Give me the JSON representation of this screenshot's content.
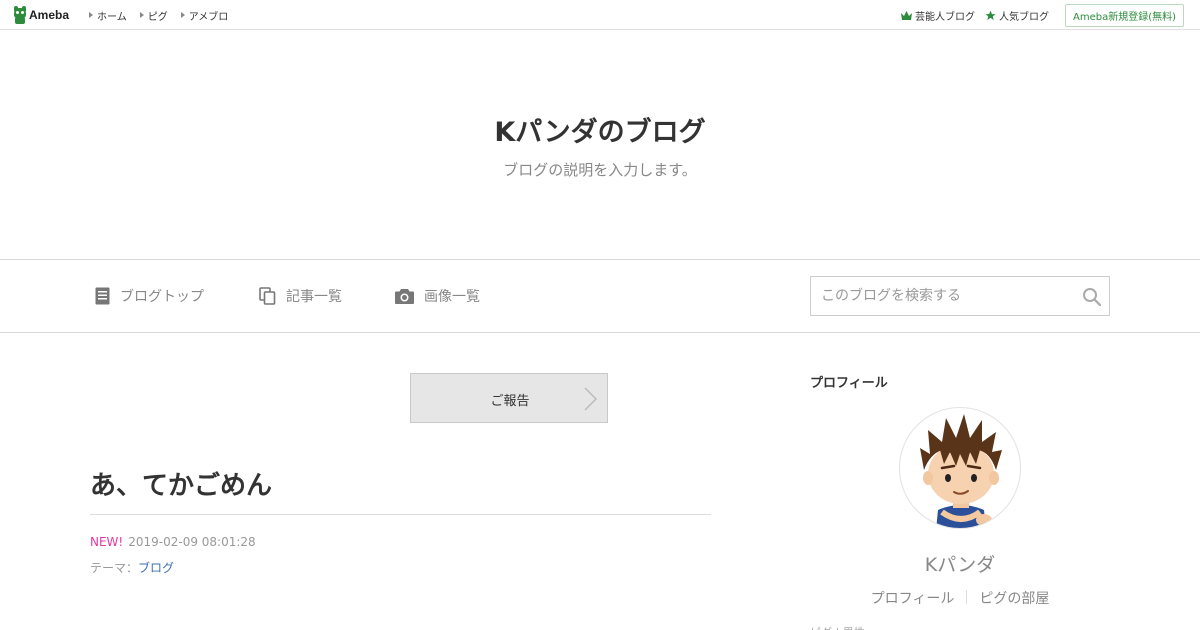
{
  "brand": {
    "logo_text": "Ameba",
    "accent": "#2d8c3c"
  },
  "topnav": {
    "items": [
      {
        "label": "ホーム"
      },
      {
        "label": "ピグ"
      },
      {
        "label": "アメブロ"
      }
    ]
  },
  "topright": {
    "celebrity_blog": "芸能人ブログ",
    "popular_blog": "人気ブログ",
    "register": "Ameba新規登録(無料)"
  },
  "header": {
    "title": "Kパンダのブログ",
    "description": "ブログの説明を入力します。"
  },
  "blognav": {
    "items": [
      {
        "label": "ブログトップ",
        "icon": "document-icon"
      },
      {
        "label": "記事一覧",
        "icon": "copy-icon"
      },
      {
        "label": "画像一覧",
        "icon": "camera-icon"
      }
    ],
    "search_placeholder": "このブログを検索する"
  },
  "main": {
    "report_button": "ご報告",
    "entry": {
      "title": "あ、てかごめん",
      "new_badge": "NEW!",
      "datetime": "2019-02-09 08:01:28",
      "theme_label": "テーマ：",
      "theme_value": "ブログ"
    }
  },
  "sidebar": {
    "heading": "プロフィール",
    "name": "Kパンダ",
    "links": [
      "プロフィール",
      "ピグの部屋"
    ],
    "cut_text": "ピグ | 男性"
  },
  "colors": {
    "new_badge": "#e23aa6",
    "link": "#3a6fb5",
    "muted": "#888888"
  }
}
